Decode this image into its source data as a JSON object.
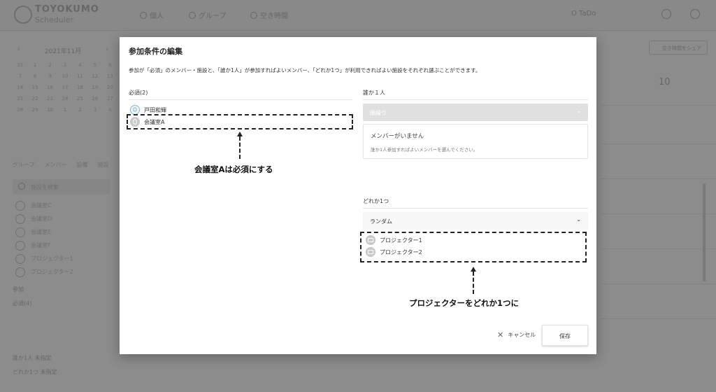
{
  "app": {
    "logo_title": "TOYOKUMO",
    "logo_sub": "Scheduler",
    "nav_personal": "個人",
    "nav_group": "グループ",
    "nav_free": "空き時間",
    "user": "O TaDo",
    "month": "2021年11月",
    "share": "空き時間をシェア",
    "day": "10",
    "left_tabs": [
      "グループ",
      "メンバー",
      "設備",
      "施設"
    ],
    "search_placeholder": "施設を検索",
    "left_items": [
      "会議室C",
      "会議室D",
      "会議室E",
      "会議室F",
      "プロジェクター1",
      "プロジェクター2"
    ],
    "left_foot": [
      "参加",
      "必須(4)",
      "誰か1人",
      "どれか1つ"
    ],
    "left_foot_values": [
      "未指定",
      "未指定"
    ]
  },
  "modal": {
    "title": "参加条件の編集",
    "description": "参加が「必須」のメンバー・施設と、「誰か1人」が参加すればよいメンバー、「どれか1つ」が利用できればよい施設をそれぞれ選ぶことができます。",
    "required": {
      "label": "必須(2)",
      "items": [
        {
          "name": "戸田和輝",
          "icon": "person-icon"
        },
        {
          "name": "会議室A",
          "icon": "location-pin-icon"
        }
      ]
    },
    "anyone": {
      "label": "誰か１人",
      "select_value": "順繰り",
      "empty_title": "メンバーがいません",
      "empty_sub": "誰か1人参加すればよいメンバーを選んでください。"
    },
    "anyone_facility": {
      "label": "どれか1つ",
      "select_value": "ランダム",
      "items": [
        {
          "name": "プロジェクター1",
          "icon": "projector-icon"
        },
        {
          "name": "プロジェクター2",
          "icon": "projector-icon"
        }
      ]
    },
    "cancel_label": "キャンセル",
    "save_label": "保存"
  },
  "annotations": {
    "required_callout": "会議室Aは必須にする",
    "anyone_callout": "プロジェクターをどれか1つに"
  }
}
